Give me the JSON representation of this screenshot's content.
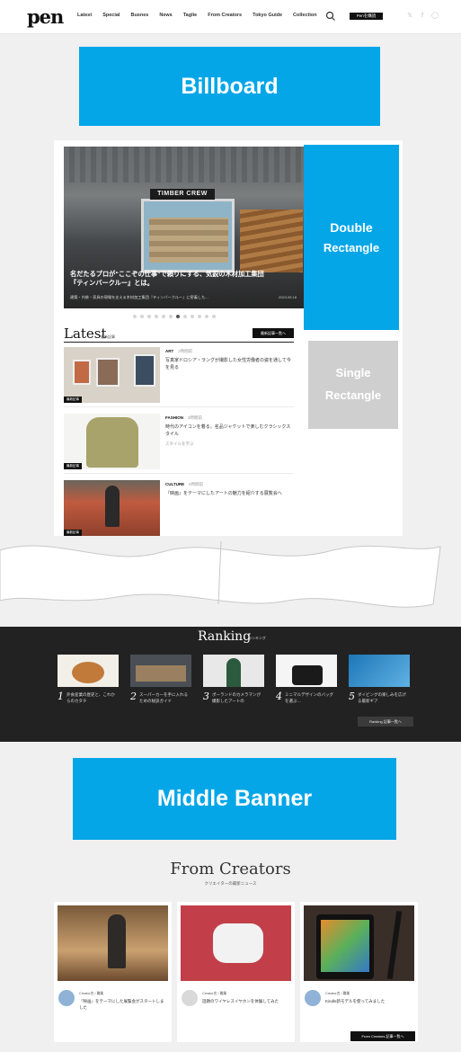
{
  "header": {
    "logo": "pen",
    "nav": [
      "Latest",
      "Special",
      "Busnes",
      "News",
      "Taglie",
      "From Creators",
      "Tokyo Guide",
      "Collection"
    ],
    "subscribe_label": "Penを購読",
    "social_icons": [
      "twitter-icon",
      "facebook-icon",
      "instagram-icon"
    ]
  },
  "ads": {
    "billboard": "Billboard",
    "double_l1": "Double",
    "double_l2": "Rectangle",
    "single_l1": "Single",
    "single_l2": "Rectangle",
    "middle": "Middle Banner"
  },
  "hero": {
    "sign": "TIMBER CREW",
    "title_l1": "名だたるプロが“ここぞの仕事”で頼りにする、気鋭の木材加工集団",
    "title_l2": "『ティンバークルー』とは。",
    "meta": "建築・内装・家具の現場を支える木材加工集団『ティンバークルー』に密着した...",
    "date": "2023.05.18",
    "slides": 12,
    "active_slide": 7
  },
  "latest": {
    "heading": "Latest",
    "sub": "最新記事",
    "more_label": "最新記事一覧へ",
    "articles": [
      {
        "category": "ART",
        "date": "2時間前",
        "title": "写真家ドロシア・ラングが撮影した女性労働者の姿を通して今を見る",
        "badge": "最新記事",
        "sub": ""
      },
      {
        "category": "FASHION",
        "date": "3時間前",
        "title": "時代のアイコンを着る。名品ジャケットで楽しむクラシックスタイル",
        "badge": "最新記事",
        "sub": "スタイルを学ぶ"
      },
      {
        "category": "CULTURE",
        "date": "5時間前",
        "title": "『映画』をテーマにしたアートの魅力を紹介する展覧会へ",
        "badge": "最新記事",
        "sub": ""
      }
    ]
  },
  "ranking": {
    "heading": "Ranking",
    "sub": "ランキング",
    "items": [
      {
        "num": "1",
        "text": "外食産業の歴史と、これからのカタチ"
      },
      {
        "num": "2",
        "text": "スーパーカーを手に入れるための秘訣ガイド"
      },
      {
        "num": "3",
        "text": "ポーランドのカメラマンが撮影したアートの"
      },
      {
        "num": "4",
        "text": "ミニマルデザインのバッグを選ぶ…"
      },
      {
        "num": "5",
        "text": "ダイビングの楽しみを広げる最新ギア"
      }
    ],
    "more_label": "Ranking 記事一覧へ"
  },
  "creators": {
    "heading": "From Creators",
    "sub": "クリエイターの最新ニュース",
    "cards": [
      {
        "name": "Creator名 / 職業",
        "title": "『映画』をテーマにした展覧会がスタートしました"
      },
      {
        "name": "Creator名 / 職業",
        "title": "話題のワイヤレスイヤホンを体験してみた"
      },
      {
        "name": "Creator名 / 職業",
        "title": "Kindle新モデルを使ってみました"
      }
    ],
    "more_label": "From Creators 記事一覧へ"
  }
}
